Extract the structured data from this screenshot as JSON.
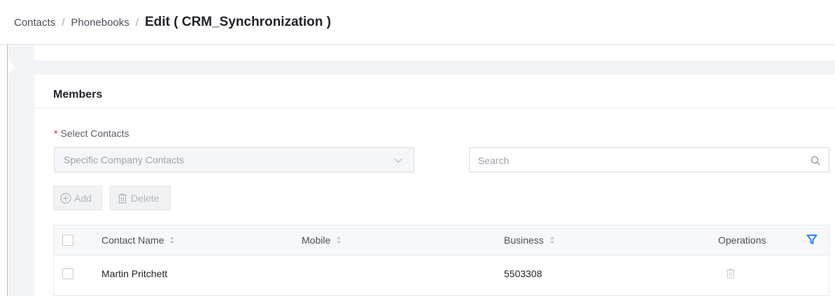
{
  "breadcrumb": {
    "items": [
      "Contacts",
      "Phonebooks"
    ],
    "separator": "/",
    "current": "Edit ( CRM_Synchronization )"
  },
  "members": {
    "title": "Members",
    "select_contacts": {
      "required_mark": "*",
      "label": "Select Contacts",
      "value": "Specific Company Contacts"
    },
    "search": {
      "placeholder": "Search",
      "value": ""
    },
    "buttons": {
      "add": "Add",
      "delete": "Delete"
    },
    "table": {
      "columns": {
        "name": "Contact Name",
        "mobile": "Mobile",
        "business": "Business",
        "operations": "Operations"
      },
      "rows": [
        {
          "name": "Martin Pritchett",
          "mobile": "",
          "business": "5503308"
        }
      ]
    }
  },
  "colors": {
    "accent": "#1677ff",
    "required": "#f5222d",
    "background": "#f3f4f7"
  },
  "icons": [
    "chevron-down-icon",
    "search-icon",
    "plus-circle-icon",
    "trash-icon",
    "sort-icon",
    "filter-icon"
  ]
}
